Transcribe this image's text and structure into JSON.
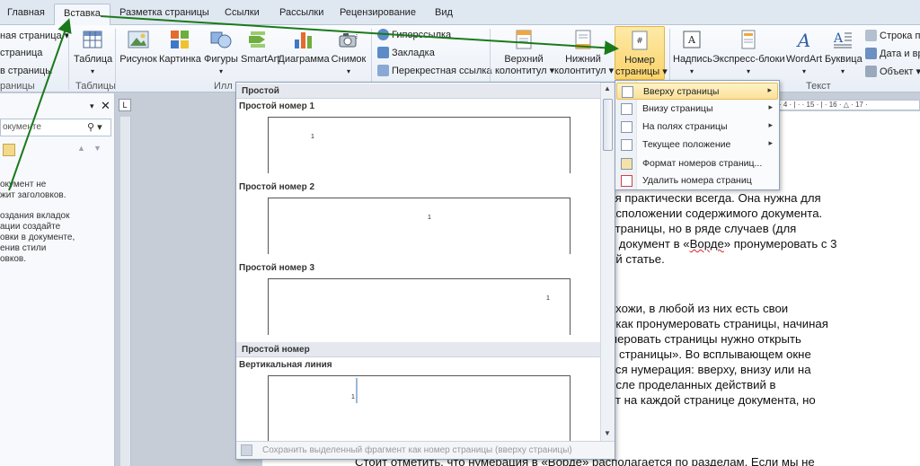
{
  "tabs": [
    "Главная",
    "Вставка",
    "Разметка страницы",
    "Ссылки",
    "Рассылки",
    "Рецензирование",
    "Вид"
  ],
  "ribbon": {
    "pages_group": {
      "items": [
        "ная страница ▾",
        "страница",
        "в страницы"
      ],
      "label": "раницы"
    },
    "table": {
      "label": "Таблица",
      "group": "Таблицы"
    },
    "illustrations": {
      "buttons": [
        "Рисунок",
        "Картинка",
        "Фигуры",
        "SmartArt",
        "Диаграмма",
        "Снимок"
      ],
      "group": "Илл"
    },
    "links": {
      "items": [
        "Гиперссылка",
        "Закладка",
        "Перекрестная ссылка"
      ]
    },
    "header_footer": {
      "header": [
        "Верхний",
        "колонтитул ▾"
      ],
      "footer": [
        "Нижний",
        "колонтитул ▾"
      ],
      "page_number": [
        "Номер",
        "страницы ▾"
      ]
    },
    "text": {
      "buttons": [
        "Надпись",
        "Экспресс-блоки",
        "WordArt",
        "Буквица"
      ],
      "group": "Текст"
    },
    "right_small": [
      "Строка п",
      "Дата и вр",
      "Объект ▾"
    ]
  },
  "nav": {
    "search_placeholder": "окументе",
    "message": [
      "окумент не",
      "жит заголовков."
    ],
    "hint": [
      "оздания вкладок",
      "ации создайте",
      "овки в документе,",
      "енив стили",
      "овков."
    ]
  },
  "ruler_marks": "· 4 · | · · 15 · | · 16 · △ · 17 ·",
  "gallery": {
    "header_top": "Простой",
    "sections": [
      {
        "title": "Простой номер 1",
        "num": "1"
      },
      {
        "title": "Простой номер 2",
        "num": "1"
      },
      {
        "title": "Простой номер 3",
        "num": "1"
      }
    ],
    "header_mid": "Простой номер",
    "section_vertical": {
      "title": "Вертикальная линия",
      "num": "1"
    },
    "footer": "Сохранить выделенный фрагмент как номер страницы (вверху страницы)"
  },
  "menu": {
    "items": [
      {
        "label": "Вверху страницы",
        "submenu": true,
        "active": true
      },
      {
        "label": "Внизу страницы",
        "submenu": true
      },
      {
        "label": "На полях страницы",
        "submenu": true
      },
      {
        "label": "Текущее положение",
        "submenu": true
      },
      {
        "label": "Формат номеров страниц..."
      },
      {
        "label": "Удалить номера страниц"
      }
    ]
  },
  "doc": {
    "lines": [
      "ся практически всегда. Она нужна для",
      "асположении содержимого документа.",
      " страницы, но в ряде случаев (для",
      "я документ в «Ворде» пронумеровать с 3",
      "ой статье.",
      "охожи, в любой из них есть свои",
      ", как пронумеровать страницы, начиная",
      "меровать страницы нужно открыть",
      "о страницы». Во всплывающем окне",
      "ься нумерация:  вверху, внизу или на",
      "осле проделанных действий в",
      "ет на каждой странице документа, но",
      "?",
      "Стоит отметить, что нумерация в «Ворде» располагается по разделам. Если мы не"
    ]
  },
  "colors": {
    "arrow": "#1a7a1a",
    "highlight": "#fbd46a",
    "ribbon_bg": "#f4f7fb"
  }
}
